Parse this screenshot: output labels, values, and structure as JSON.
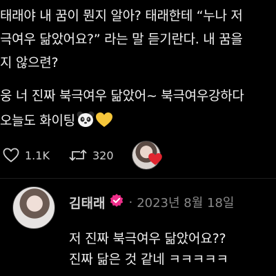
{
  "post": {
    "lines": [
      "태래야 내 꿈이 뭔지 알아? 태래한테 “누나 저",
      "극여우 닮았어요?” 라는 말 듣기란다. 내 꿈을",
      "지 않으련?",
      "웅 너 진짜 북극여우 닮았어~ 북극여우강하다",
      "오늘도 화이팅"
    ],
    "emojis": [
      "panda-face",
      "yellow-heart"
    ]
  },
  "actions": {
    "likes": "1.1K",
    "retweets": "320"
  },
  "reply": {
    "name": "김태래",
    "separator": "·",
    "date": "2023년 8월 18일",
    "lines": [
      "저 진짜 북극여우 닮았어요??",
      "진짜 닮은 것 같네 ㅋㅋㅋㅋㅋ"
    ]
  },
  "colors": {
    "background": "#000000",
    "text": "#f2f2f2",
    "muted": "#8a8a8a",
    "verified_badge": "#ee2e8a",
    "heart": "#e0252f"
  }
}
